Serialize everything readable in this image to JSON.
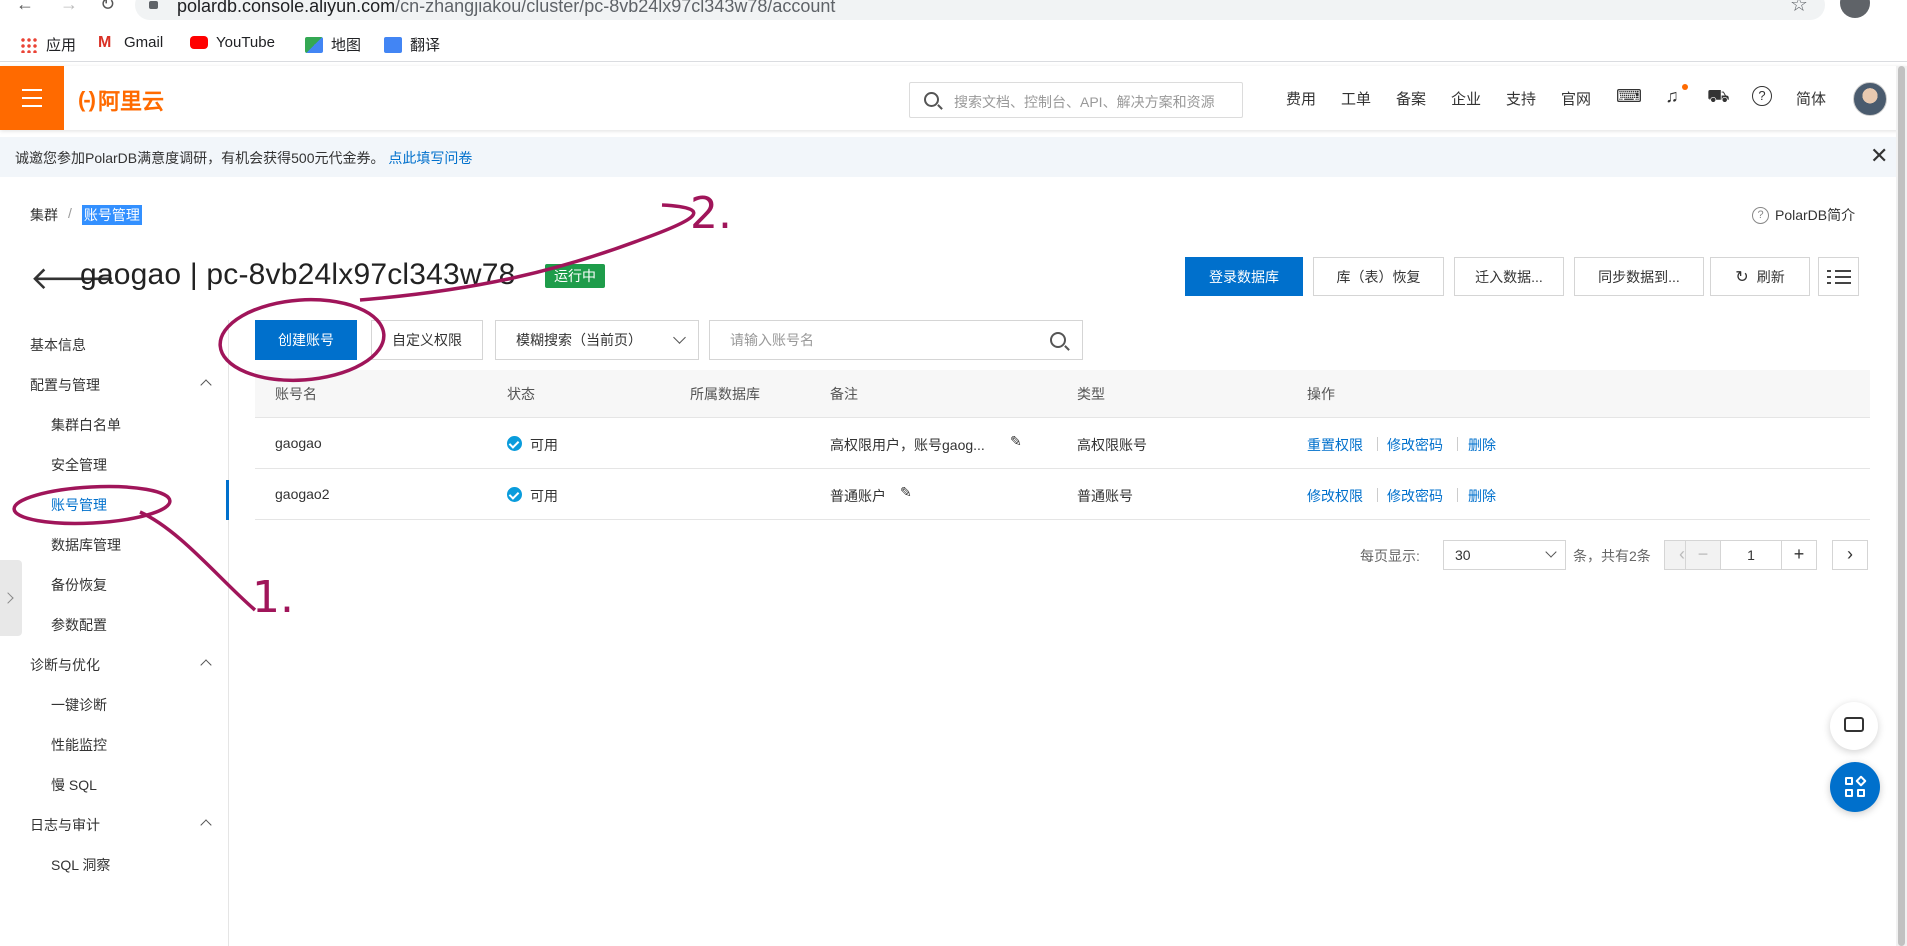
{
  "browser": {
    "url_host": "polardb.console.aliyun.com",
    "url_path": "/cn-zhangjiakou/cluster/pc-8vb24lx97cl343w78/account",
    "bookmarks": [
      "应用",
      "Gmail",
      "YouTube",
      "地图",
      "翻译"
    ]
  },
  "topnav": {
    "logo": "阿里云",
    "search_placeholder": "搜索文档、控制台、API、解决方案和资源",
    "links": [
      "费用",
      "工单",
      "备案",
      "企业",
      "支持",
      "官网"
    ],
    "lang": "简体"
  },
  "notice": {
    "text": "诚邀您参加PolarDB满意度调研，有机会获得500元代金券。",
    "link": "点此填写问卷"
  },
  "breadcrumb": {
    "parent": "集群",
    "separator": "/",
    "current": "账号管理"
  },
  "intro_link": "PolarDB简介",
  "header": {
    "title": "gaogao | pc-8vb24lx97cl343w78",
    "status": "运行中",
    "buttons": {
      "login_db": "登录数据库",
      "restore": "库（表）恢复",
      "migrate_in": "迁入数据...",
      "sync_to": "同步数据到...",
      "refresh": "刷新"
    }
  },
  "sidebar": {
    "basic": "基本信息",
    "groups": [
      {
        "label": "配置与管理",
        "items": [
          "集群白名单",
          "安全管理",
          "账号管理",
          "数据库管理",
          "备份恢复",
          "参数配置"
        ]
      },
      {
        "label": "诊断与优化",
        "items": [
          "一键诊断",
          "性能监控",
          "慢 SQL"
        ]
      },
      {
        "label": "日志与审计",
        "items": [
          "SQL 洞察"
        ]
      }
    ]
  },
  "toolbar": {
    "create": "创建账号",
    "custom": "自定义权限",
    "fuzzy": "模糊搜索（当前页）",
    "input_placeholder": "请输入账号名"
  },
  "table": {
    "headers": [
      "账号名",
      "状态",
      "所属数据库",
      "备注",
      "类型",
      "操作"
    ],
    "rows": [
      {
        "name": "gaogao",
        "status": "可用",
        "db": "",
        "remark": "高权限用户，账号gaog...",
        "type": "高权限账号",
        "ops": [
          "重置权限",
          "修改密码",
          "删除"
        ]
      },
      {
        "name": "gaogao2",
        "status": "可用",
        "db": "",
        "remark": "普通账户",
        "type": "普通账号",
        "ops": [
          "修改权限",
          "修改密码",
          "删除"
        ]
      }
    ]
  },
  "pagination": {
    "per_page_label": "每页显示:",
    "per_page": "30",
    "total": "条，共有2条",
    "page": "1"
  },
  "annotations": [
    "1.",
    "2."
  ],
  "colors": {
    "brand": "#ff6a00",
    "primary": "#0070cc",
    "running": "#1e9c4a",
    "annotation": "#a0155a"
  }
}
